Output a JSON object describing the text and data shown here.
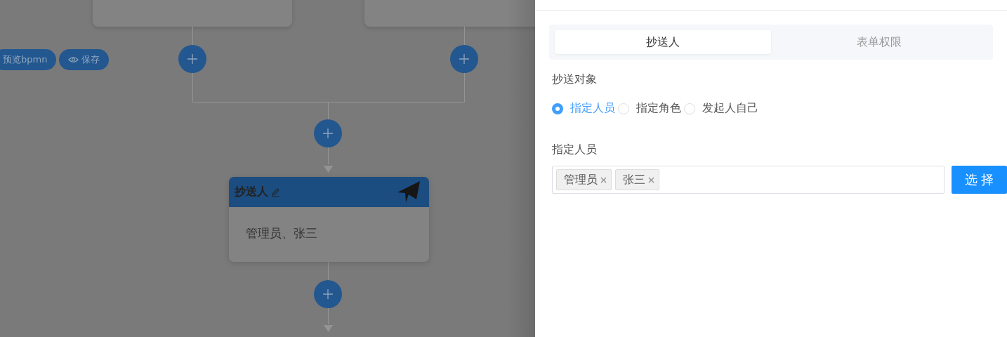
{
  "toolbar": {
    "buttons": [
      {
        "label": "预览bpmn",
        "kind": "text"
      },
      {
        "label": "保存",
        "kind": "eye"
      }
    ]
  },
  "flow": {
    "node": {
      "title": "抄送人",
      "content": "管理员、张三"
    }
  },
  "drawer": {
    "tabs": [
      {
        "label": "抄送人",
        "selected": true
      },
      {
        "label": "表单权限",
        "selected": false
      }
    ],
    "target_label": "抄送对象",
    "options": [
      {
        "label": "指定人员",
        "selected": true
      },
      {
        "label": "指定角色",
        "selected": false
      },
      {
        "label": "发起人自己",
        "selected": false
      }
    ],
    "members_label": "指定人员",
    "tags": [
      {
        "label": "管理员"
      },
      {
        "label": "张三"
      }
    ],
    "select_button": "选 择"
  }
}
